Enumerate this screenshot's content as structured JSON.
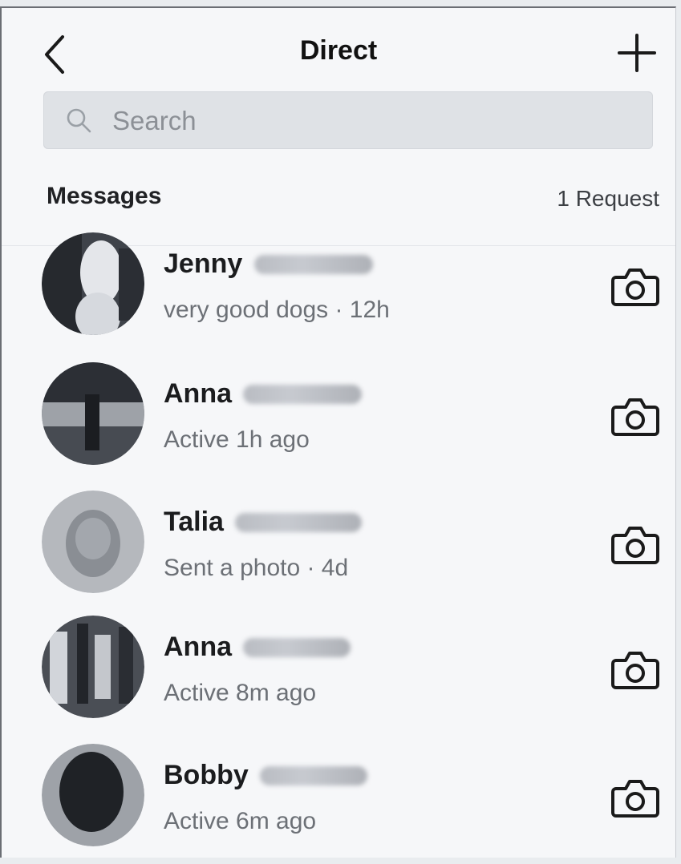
{
  "header": {
    "title": "Direct"
  },
  "search": {
    "placeholder": "Search"
  },
  "messages_section": {
    "title": "Messages",
    "requests_label": "1 Request"
  },
  "threads": [
    {
      "name": "Jenny",
      "preview": "very good dogs · 12h",
      "avatar_color": "#4b4f56"
    },
    {
      "name": "Anna",
      "preview": "Active 1h ago",
      "avatar_color": "#3a3e45"
    },
    {
      "name": "Talia",
      "preview": "Sent a photo · 4d",
      "avatar_color": "#8d9096"
    },
    {
      "name": "Anna",
      "preview": "Active 8m ago",
      "avatar_color": "#44484f"
    },
    {
      "name": "Bobby",
      "preview": "Active 6m ago",
      "avatar_color": "#2e3137"
    }
  ],
  "icons": {
    "back": "chevron-left-icon",
    "new_message": "plus-icon",
    "search": "search-icon",
    "camera": "camera-icon"
  }
}
